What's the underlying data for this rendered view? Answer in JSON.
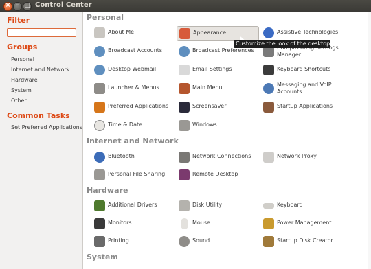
{
  "window": {
    "title": "Control Center"
  },
  "sidebar": {
    "filter_heading": "Filter",
    "groups_heading": "Groups",
    "groups": [
      "Personal",
      "Internet and Network",
      "Hardware",
      "System",
      "Other"
    ],
    "tasks_heading": "Common Tasks",
    "tasks": [
      "Set Preferred Applications"
    ]
  },
  "sections": {
    "personal": {
      "title": "Personal",
      "items": [
        {
          "label": "About Me",
          "icon": "about-me-icon"
        },
        {
          "label": "Appearance",
          "icon": "appearance-icon"
        },
        {
          "label": "Assistive Technologies",
          "icon": "accessibility-icon"
        },
        {
          "label": "Broadcast Accounts",
          "icon": "broadcast-icon"
        },
        {
          "label": "Broadcast Preferences",
          "icon": "broadcast-prefs-icon"
        },
        {
          "label": "Compizconfig Settings Manager",
          "icon": "compiz-icon"
        },
        {
          "label": "Desktop Webmail",
          "icon": "webmail-icon"
        },
        {
          "label": "Email Settings",
          "icon": "email-icon"
        },
        {
          "label": "Keyboard Shortcuts",
          "icon": "keyboard-shortcuts-icon"
        },
        {
          "label": "Launcher & Menus",
          "icon": "launcher-icon"
        },
        {
          "label": "Main Menu",
          "icon": "main-menu-icon"
        },
        {
          "label": "Messaging and VoIP Accounts",
          "icon": "messaging-icon"
        },
        {
          "label": "Preferred Applications",
          "icon": "preferred-apps-icon"
        },
        {
          "label": "Screensaver",
          "icon": "screensaver-icon"
        },
        {
          "label": "Startup Applications",
          "icon": "startup-apps-icon"
        },
        {
          "label": "Time & Date",
          "icon": "clock-icon"
        },
        {
          "label": "Windows",
          "icon": "windows-icon"
        }
      ]
    },
    "internet": {
      "title": "Internet and Network",
      "items": [
        {
          "label": "Bluetooth",
          "icon": "bluetooth-icon"
        },
        {
          "label": "Network Connections",
          "icon": "network-connections-icon"
        },
        {
          "label": "Network Proxy",
          "icon": "network-proxy-icon"
        },
        {
          "label": "Personal File Sharing",
          "icon": "file-sharing-icon"
        },
        {
          "label": "Remote Desktop",
          "icon": "remote-desktop-icon"
        }
      ]
    },
    "hardware": {
      "title": "Hardware",
      "items": [
        {
          "label": "Additional Drivers",
          "icon": "drivers-icon"
        },
        {
          "label": "Disk Utility",
          "icon": "disk-utility-icon"
        },
        {
          "label": "Keyboard",
          "icon": "keyboard-icon"
        },
        {
          "label": "Monitors",
          "icon": "monitor-icon"
        },
        {
          "label": "Mouse",
          "icon": "mouse-icon"
        },
        {
          "label": "Power Management",
          "icon": "power-icon"
        },
        {
          "label": "Printing",
          "icon": "printer-icon"
        },
        {
          "label": "Sound",
          "icon": "sound-icon"
        },
        {
          "label": "Startup Disk Creator",
          "icon": "startup-disk-icon"
        }
      ]
    },
    "system": {
      "title": "System"
    }
  },
  "tooltip": "Customize the look of the desktop",
  "colors": {
    "accent": "#dd4814",
    "section": "#8a8a8a",
    "titlebar": "#3c3b37"
  }
}
